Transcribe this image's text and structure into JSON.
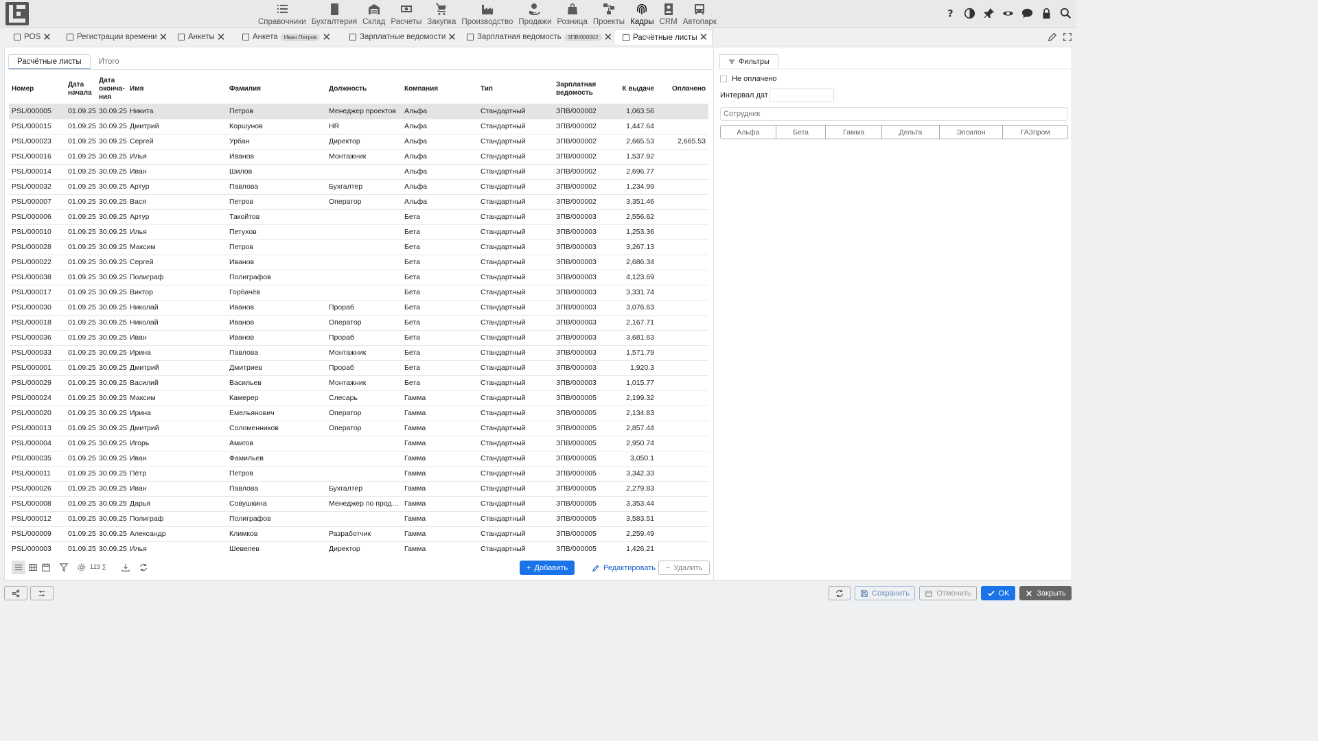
{
  "nav": {
    "items": [
      {
        "label": "Справочники",
        "icon": "list-icon"
      },
      {
        "label": "Бухгалтерия",
        "icon": "ledger-icon"
      },
      {
        "label": "Склад",
        "icon": "warehouse-icon"
      },
      {
        "label": "Расчеты",
        "icon": "money-icon"
      },
      {
        "label": "Закупка",
        "icon": "cart-icon"
      },
      {
        "label": "Производство",
        "icon": "factory-icon"
      },
      {
        "label": "Продажи",
        "icon": "hand-money-icon"
      },
      {
        "label": "Розница",
        "icon": "bag-icon"
      },
      {
        "label": "Проекты",
        "icon": "network-icon"
      },
      {
        "label": "Кадры",
        "icon": "fingerprint-icon"
      },
      {
        "label": "CRM",
        "icon": "crm-icon"
      },
      {
        "label": "Автопарк",
        "icon": "bus-icon"
      }
    ],
    "active": "Кадры"
  },
  "doc_tabs": [
    {
      "label": "POS"
    },
    {
      "label": "Регистрации времени"
    },
    {
      "label": "Анкеты"
    },
    {
      "label": "Анкета",
      "chip": "Иван Петров"
    },
    {
      "label": "Зарплатные ведомости"
    },
    {
      "label": "Зарплатная ведомость",
      "chip": "ЗПВ/000002"
    },
    {
      "label": "Расчётные листы"
    }
  ],
  "subtabs": [
    "Расчётные листы",
    "Итого"
  ],
  "table": {
    "headers": [
      "Номер",
      "Дата начала",
      "Дата оконча­ния",
      "Имя",
      "Фамилия",
      "Должность",
      "Компания",
      "Тип",
      "Зарплатная ведомость",
      "К выдаче",
      "Оплачено"
    ],
    "rows": [
      [
        "PSL/000005",
        "01.09.25",
        "30.09.25",
        "Никита",
        "Петров",
        "Менеджер проектов",
        "Альфа",
        "Стандартный",
        "ЗПВ/000002",
        "1,063.56",
        ""
      ],
      [
        "PSL/000015",
        "01.09.25",
        "30.09.25",
        "Дмитрий",
        "Коршунов",
        "HR",
        "Альфа",
        "Стандартный",
        "ЗПВ/000002",
        "1,447.64",
        ""
      ],
      [
        "PSL/000023",
        "01.09.25",
        "30.09.25",
        "Сергей",
        "Урбан",
        "Директор",
        "Альфа",
        "Стандартный",
        "ЗПВ/000002",
        "2,665.53",
        "2,665.53"
      ],
      [
        "PSL/000016",
        "01.09.25",
        "30.09.25",
        "Илья",
        "Иванов",
        "Монтажник",
        "Альфа",
        "Стандартный",
        "ЗПВ/000002",
        "1,537.92",
        ""
      ],
      [
        "PSL/000014",
        "01.09.25",
        "30.09.25",
        "Иван",
        "Шилов",
        "",
        "Альфа",
        "Стандартный",
        "ЗПВ/000002",
        "2,696.77",
        ""
      ],
      [
        "PSL/000032",
        "01.09.25",
        "30.09.25",
        "Артур",
        "Павлова",
        "Бухгалтер",
        "Альфа",
        "Стандартный",
        "ЗПВ/000002",
        "1,234.99",
        ""
      ],
      [
        "PSL/000007",
        "01.09.25",
        "30.09.25",
        "Вася",
        "Петров",
        "Оператор",
        "Альфа",
        "Стандартный",
        "ЗПВ/000002",
        "3,351.46",
        ""
      ],
      [
        "PSL/000006",
        "01.09.25",
        "30.09.25",
        "Артур",
        "Такойтов",
        "",
        "Бета",
        "Стандартный",
        "ЗПВ/000003",
        "2,556.62",
        ""
      ],
      [
        "PSL/000010",
        "01.09.25",
        "30.09.25",
        "Илья",
        "Петухов",
        "",
        "Бета",
        "Стандартный",
        "ЗПВ/000003",
        "1,253.36",
        ""
      ],
      [
        "PSL/000028",
        "01.09.25",
        "30.09.25",
        "Максим",
        "Петров",
        "",
        "Бета",
        "Стандартный",
        "ЗПВ/000003",
        "3,267.13",
        ""
      ],
      [
        "PSL/000022",
        "01.09.25",
        "30.09.25",
        "Сергей",
        "Иванов",
        "",
        "Бета",
        "Стандартный",
        "ЗПВ/000003",
        "2,686.34",
        ""
      ],
      [
        "PSL/000038",
        "01.09.25",
        "30.09.25",
        "Полиграф",
        "Полиграфов",
        "",
        "Бета",
        "Стандартный",
        "ЗПВ/000003",
        "4,123.69",
        ""
      ],
      [
        "PSL/000017",
        "01.09.25",
        "30.09.25",
        "Виктор",
        "Горбачёв",
        "",
        "Бета",
        "Стандартный",
        "ЗПВ/000003",
        "3,331.74",
        ""
      ],
      [
        "PSL/000030",
        "01.09.25",
        "30.09.25",
        "Николай",
        "Иванов",
        "Прораб",
        "Бета",
        "Стандартный",
        "ЗПВ/000003",
        "3,076.63",
        ""
      ],
      [
        "PSL/000018",
        "01.09.25",
        "30.09.25",
        "Николай",
        "Иванов",
        "Оператор",
        "Бета",
        "Стандартный",
        "ЗПВ/000003",
        "2,167.71",
        ""
      ],
      [
        "PSL/000036",
        "01.09.25",
        "30.09.25",
        "Иван",
        "Иванов",
        "Прораб",
        "Бета",
        "Стандартный",
        "ЗПВ/000003",
        "3,681.63",
        ""
      ],
      [
        "PSL/000033",
        "01.09.25",
        "30.09.25",
        "Ирина",
        "Павлова",
        "Монтажник",
        "Бета",
        "Стандартный",
        "ЗПВ/000003",
        "1,571.79",
        ""
      ],
      [
        "PSL/000001",
        "01.09.25",
        "30.09.25",
        "Дмитрий",
        "Дмитриев",
        "Прораб",
        "Бета",
        "Стандартный",
        "ЗПВ/000003",
        "1,920.3",
        ""
      ],
      [
        "PSL/000029",
        "01.09.25",
        "30.09.25",
        "Василий",
        "Васильев",
        "Монтажник",
        "Бета",
        "Стандартный",
        "ЗПВ/000003",
        "1,015.77",
        ""
      ],
      [
        "PSL/000024",
        "01.09.25",
        "30.09.25",
        "Максим",
        "Камерер",
        "Слесарь",
        "Гамма",
        "Стандартный",
        "ЗПВ/000005",
        "2,199.32",
        ""
      ],
      [
        "PSL/000020",
        "01.09.25",
        "30.09.25",
        "Ирина",
        "Емельянович",
        "Оператор",
        "Гамма",
        "Стандартный",
        "ЗПВ/000005",
        "2,134.83",
        ""
      ],
      [
        "PSL/000013",
        "01.09.25",
        "30.09.25",
        "Дмитрий",
        "Соломенников",
        "Оператор",
        "Гамма",
        "Стандартный",
        "ЗПВ/000005",
        "2,857.44",
        ""
      ],
      [
        "PSL/000004",
        "01.09.25",
        "30.09.25",
        "Игорь",
        "Амигов",
        "",
        "Гамма",
        "Стандартный",
        "ЗПВ/000005",
        "2,950.74",
        ""
      ],
      [
        "PSL/000035",
        "01.09.25",
        "30.09.25",
        "Иван",
        "Фамильев",
        "",
        "Гамма",
        "Стандартный",
        "ЗПВ/000005",
        "3,050.1",
        ""
      ],
      [
        "PSL/000011",
        "01.09.25",
        "30.09.25",
        "Пётр",
        "Петров",
        "",
        "Гамма",
        "Стандартный",
        "ЗПВ/000005",
        "3,342.33",
        ""
      ],
      [
        "PSL/000026",
        "01.09.25",
        "30.09.25",
        "Иван",
        "Павлова",
        "Бухгалтер",
        "Гамма",
        "Стандартный",
        "ЗПВ/000005",
        "2,279.83",
        ""
      ],
      [
        "PSL/000008",
        "01.09.25",
        "30.09.25",
        "Дарья",
        "Совушкина",
        "Менеджер по продажам",
        "Гамма",
        "Стандартный",
        "ЗПВ/000005",
        "3,353.44",
        ""
      ],
      [
        "PSL/000012",
        "01.09.25",
        "30.09.25",
        "Полиграф",
        "Полиграфов",
        "",
        "Гамма",
        "Стандартный",
        "ЗПВ/000005",
        "3,583.51",
        ""
      ],
      [
        "PSL/000009",
        "01.09.25",
        "30.09.25",
        "Александр",
        "Климков",
        "Разработчик",
        "Гамма",
        "Стандартный",
        "ЗПВ/000005",
        "2,259.49",
        ""
      ],
      [
        "PSL/000003",
        "01.09.25",
        "30.09.25",
        "Илья",
        "Шевелев",
        "Директор",
        "Гамма",
        "Стандартный",
        "ЗПВ/000005",
        "1,426.21",
        ""
      ]
    ]
  },
  "table_footer": {
    "count_label": "123 ∑",
    "add_label": "Добавить",
    "edit_label": "Редактировать",
    "delete_label": "Удалить"
  },
  "filters": {
    "tab_label": "Фильтры",
    "unpaid_label": "Не оплачено",
    "date_interval_label": "Интервал дат",
    "employee_placeholder": "Сотрудник",
    "companies": [
      "Альфа",
      "Бета",
      "Гамма",
      "Дельта",
      "Эпсилон",
      "ГАЗпром"
    ]
  },
  "bottom": {
    "save_label": "Сохранить",
    "cancel_label": "Отменить",
    "ok_label": "OK",
    "close_label": "Закрыть"
  }
}
